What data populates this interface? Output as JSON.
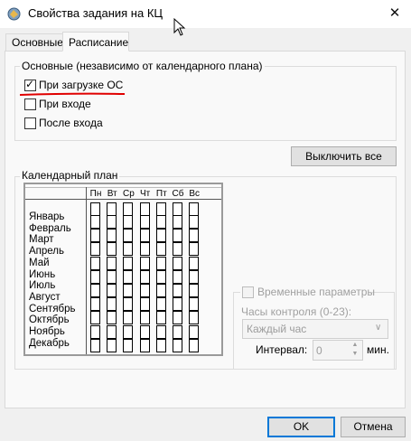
{
  "window": {
    "title": "Свойства задания на КЦ",
    "close_glyph": "✕"
  },
  "tabs": {
    "main": "Основные",
    "schedule": "Расписание"
  },
  "basic_group": {
    "title": "Основные (независимо от календарного плана)",
    "options": [
      {
        "label": "При загрузке ОС",
        "checked": true
      },
      {
        "label": "При входе",
        "checked": false
      },
      {
        "label": "После входа",
        "checked": false
      }
    ]
  },
  "disable_all_button": "Выключить все",
  "calendar": {
    "title": "Календарный план",
    "days": [
      "Пн",
      "Вт",
      "Ср",
      "Чт",
      "Пт",
      "Сб",
      "Вс"
    ],
    "months": [
      "Январь",
      "Февраль",
      "Март",
      "Апрель",
      "Май",
      "Июнь",
      "Июль",
      "Август",
      "Сентябрь",
      "Октябрь",
      "Ноябрь",
      "Декабрь"
    ]
  },
  "time_params": {
    "checkbox_label": "Временные параметры",
    "enabled": false,
    "hours_label": "Часы контроля (0-23):",
    "hours_value": "Каждый час",
    "interval_label": "Интервал:",
    "interval_value": "0",
    "interval_unit": "мин."
  },
  "footer": {
    "ok": "OK",
    "cancel": "Отмена"
  },
  "icons": {
    "app": "app-icon",
    "close": "close-icon",
    "cursor": "mouse-cursor-icon"
  }
}
